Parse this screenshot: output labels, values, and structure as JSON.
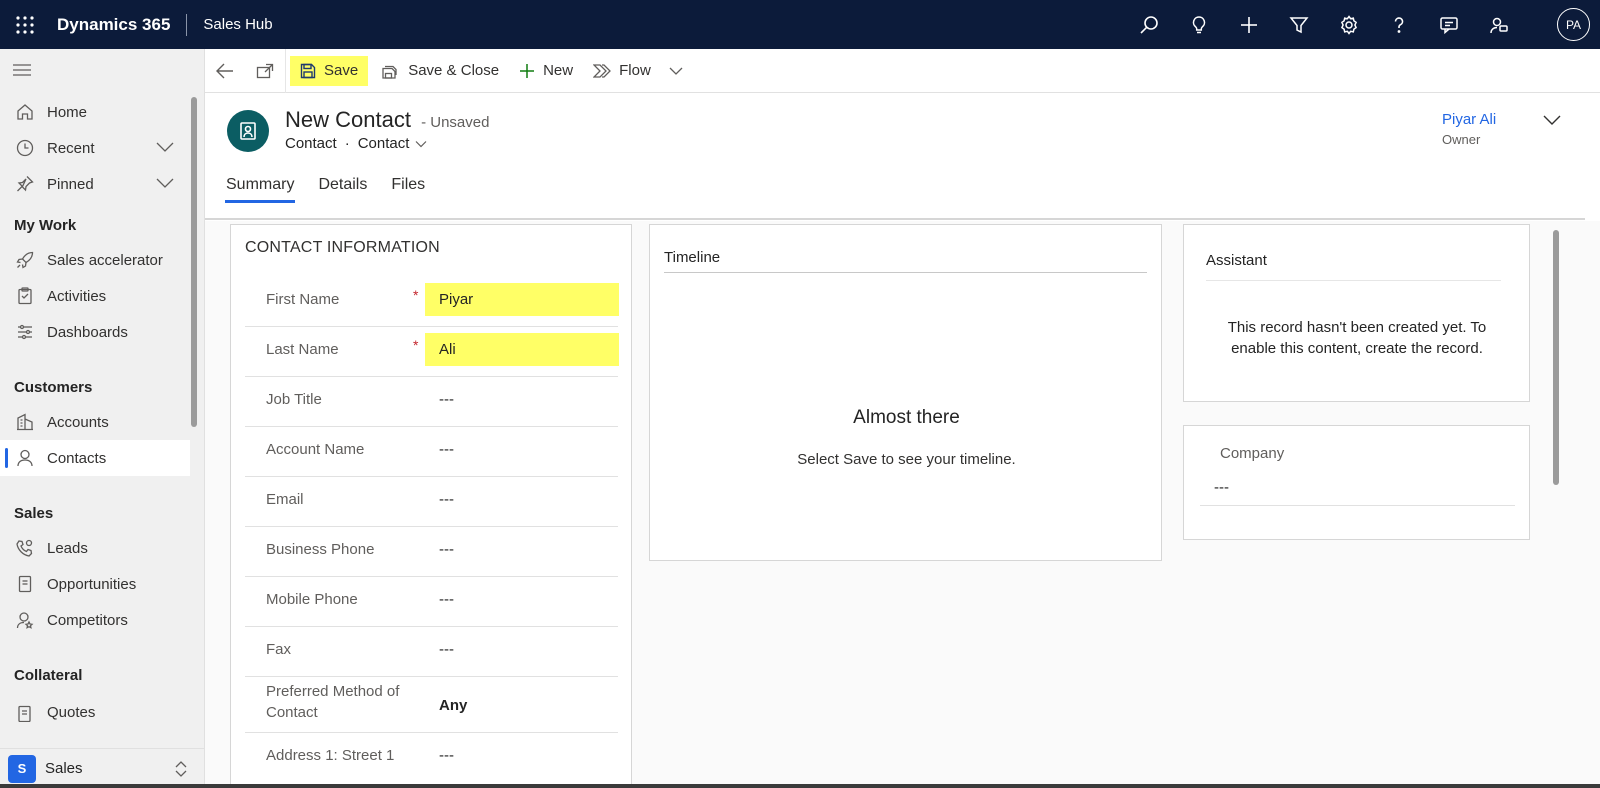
{
  "topbar": {
    "app_name": "Dynamics 365",
    "area_name": "Sales Hub",
    "user_initials": "PA",
    "icons": [
      "search-icon",
      "lightbulb-icon",
      "plus-icon",
      "filter-icon",
      "gear-icon",
      "help-icon",
      "chat-icon",
      "person-feedback-icon"
    ]
  },
  "sidebar": {
    "top_items": [
      {
        "label": "Home",
        "icon": "home-icon"
      },
      {
        "label": "Recent",
        "icon": "clock-icon",
        "expandable": true
      },
      {
        "label": "Pinned",
        "icon": "pin-icon",
        "expandable": true
      }
    ],
    "groups": [
      {
        "title": "My Work",
        "items": [
          {
            "label": "Sales accelerator",
            "icon": "rocket-icon"
          },
          {
            "label": "Activities",
            "icon": "clipboard-icon"
          },
          {
            "label": "Dashboards",
            "icon": "dashboard-icon"
          }
        ]
      },
      {
        "title": "Customers",
        "items": [
          {
            "label": "Accounts",
            "icon": "building-icon"
          },
          {
            "label": "Contacts",
            "icon": "person-icon",
            "active": true
          }
        ]
      },
      {
        "title": "Sales",
        "items": [
          {
            "label": "Leads",
            "icon": "phone-person-icon"
          },
          {
            "label": "Opportunities",
            "icon": "document-icon"
          },
          {
            "label": "Competitors",
            "icon": "person-star-icon"
          }
        ]
      },
      {
        "title": "Collateral",
        "items": [
          {
            "label": "Quotes",
            "icon": "quote-icon"
          }
        ]
      }
    ],
    "area_switcher": {
      "badge": "S",
      "label": "Sales"
    }
  },
  "commandbar": {
    "save": "Save",
    "save_close": "Save & Close",
    "new": "New",
    "flow": "Flow"
  },
  "record": {
    "title": "New Contact",
    "status": "- Unsaved",
    "entity": "Contact",
    "form": "Contact",
    "owner_name": "Piyar Ali",
    "owner_label": "Owner"
  },
  "tabs": [
    {
      "label": "Summary",
      "active": true
    },
    {
      "label": "Details"
    },
    {
      "label": "Files"
    }
  ],
  "contact_info": {
    "title": "CONTACT INFORMATION",
    "fields": [
      {
        "label": "First Name",
        "value": "Piyar",
        "required": true,
        "highlight": true
      },
      {
        "label": "Last Name",
        "value": "Ali",
        "required": true,
        "highlight": true
      },
      {
        "label": "Job Title",
        "value": "---"
      },
      {
        "label": "Account Name",
        "value": "---"
      },
      {
        "label": "Email",
        "value": "---"
      },
      {
        "label": "Business Phone",
        "value": "---"
      },
      {
        "label": "Mobile Phone",
        "value": "---"
      },
      {
        "label": "Fax",
        "value": "---"
      },
      {
        "label": "Preferred Method of Contact",
        "value": "Any",
        "bold": true
      },
      {
        "label": "Address 1: Street 1",
        "value": "---"
      }
    ]
  },
  "timeline": {
    "title": "Timeline",
    "heading": "Almost there",
    "text": "Select Save to see your timeline."
  },
  "assistant": {
    "title": "Assistant",
    "text": "This record hasn't been created yet. To enable this content, create the record."
  },
  "company": {
    "label": "Company",
    "value": "---"
  },
  "colors": {
    "topbar": "#0c1b3a",
    "accent": "#2266e3",
    "highlight": "#ffff66",
    "record_avatar": "#0b5d63",
    "required": "#c4262e"
  }
}
